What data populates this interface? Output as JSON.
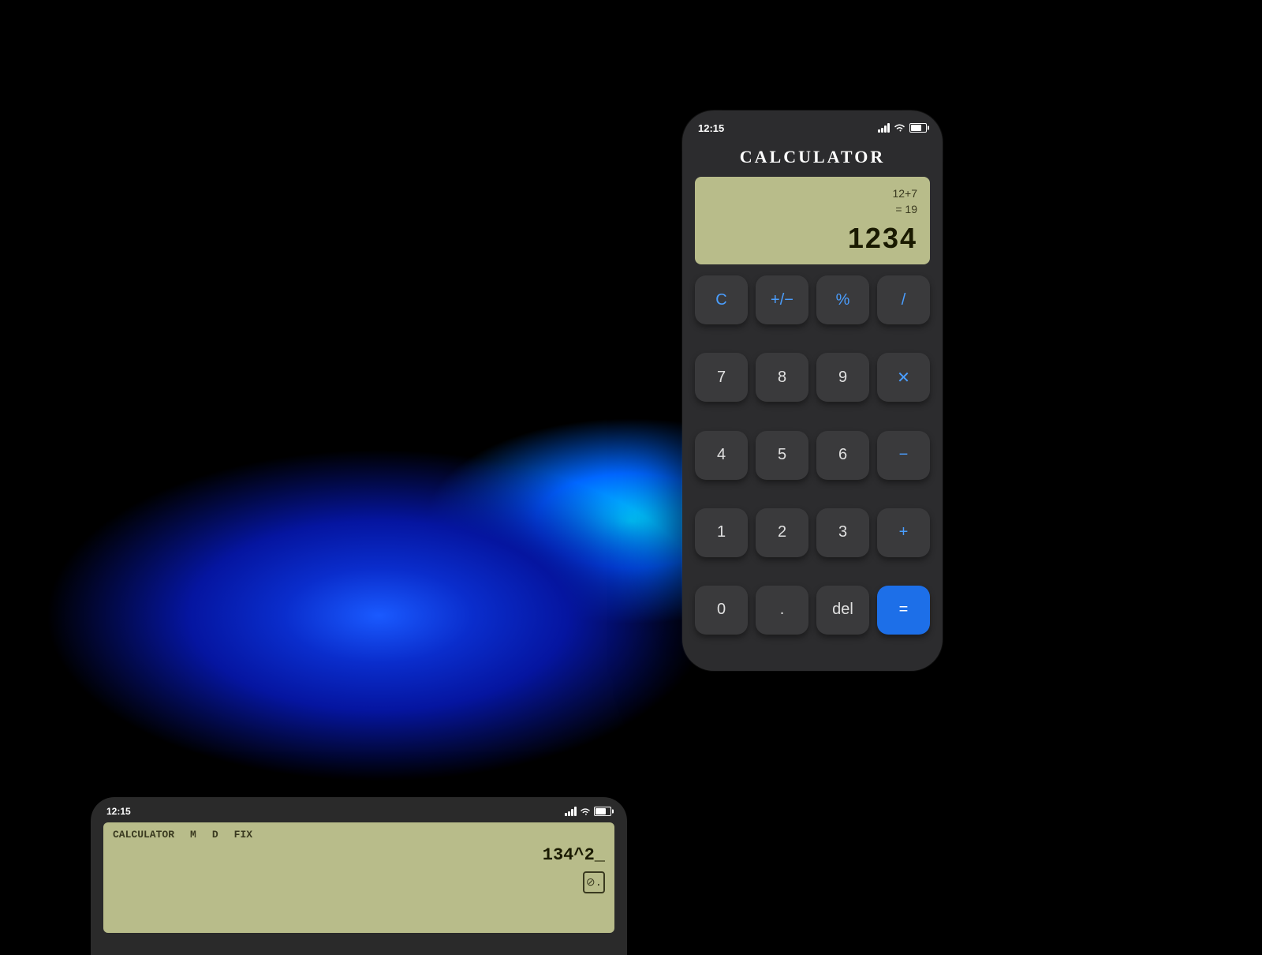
{
  "background": {
    "color": "#000000"
  },
  "phone_main": {
    "status_bar": {
      "time": "12:15",
      "battery_level": "70%"
    },
    "app_title": "CALCULATOR",
    "display": {
      "history_line1": "12+7",
      "history_line2": "= 19",
      "current_value": "1234"
    },
    "buttons": [
      {
        "label": "C",
        "type": "blue-text",
        "row": 1,
        "col": 1
      },
      {
        "label": "+/-",
        "type": "blue-text",
        "row": 1,
        "col": 2
      },
      {
        "label": "%",
        "type": "blue-text",
        "row": 1,
        "col": 3
      },
      {
        "label": "/",
        "type": "blue-text",
        "row": 1,
        "col": 4
      },
      {
        "label": "7",
        "type": "normal",
        "row": 2,
        "col": 1
      },
      {
        "label": "8",
        "type": "normal",
        "row": 2,
        "col": 2
      },
      {
        "label": "9",
        "type": "normal",
        "row": 2,
        "col": 3
      },
      {
        "label": "X",
        "type": "blue-text",
        "row": 2,
        "col": 4
      },
      {
        "label": "4",
        "type": "normal",
        "row": 3,
        "col": 1
      },
      {
        "label": "5",
        "type": "normal",
        "row": 3,
        "col": 2
      },
      {
        "label": "6",
        "type": "normal",
        "row": 3,
        "col": 3
      },
      {
        "label": "−",
        "type": "blue-text",
        "row": 3,
        "col": 4
      },
      {
        "label": "1",
        "type": "normal",
        "row": 4,
        "col": 1
      },
      {
        "label": "2",
        "type": "normal",
        "row": 4,
        "col": 2
      },
      {
        "label": "3",
        "type": "normal",
        "row": 4,
        "col": 3
      },
      {
        "label": "+",
        "type": "blue-text",
        "row": 4,
        "col": 4
      },
      {
        "label": "0",
        "type": "normal",
        "row": 5,
        "col": 1
      },
      {
        "label": ".",
        "type": "normal",
        "row": 5,
        "col": 2
      },
      {
        "label": "del",
        "type": "normal",
        "row": 5,
        "col": 3
      },
      {
        "label": "=",
        "type": "blue-bg",
        "row": 5,
        "col": 4
      }
    ]
  },
  "phone_secondary": {
    "status_bar": {
      "time": "12:15"
    },
    "display": {
      "labels": [
        "CALCULATOR",
        "M",
        "D",
        "FIX"
      ],
      "expression": "134^2_",
      "corner_icon": "⊘."
    }
  }
}
